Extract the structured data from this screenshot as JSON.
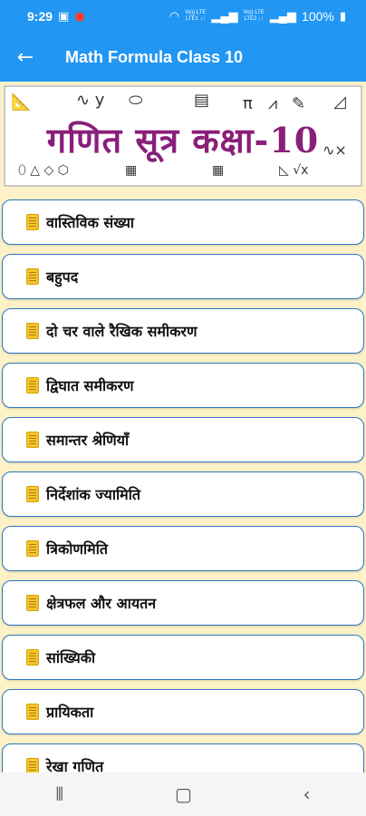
{
  "status": {
    "time": "9:29",
    "lte1": "Vo)) LTE\nLTE1 ↓↑",
    "lte2": "Vo)) LTE\nLTE2 ↓↑",
    "battery": "100%"
  },
  "appbar": {
    "title": "Math Formula Class 10"
  },
  "banner": {
    "title": "गणित सूत्र कक्षा-10"
  },
  "topics": [
    "वास्तिविक संख्या",
    "बहुपद",
    "दो चर वाले रैखिक समीकरण",
    "द्विघात समीकरण",
    "समान्तर श्रेणियाँ",
    "निर्देशांक ज्यामिति",
    "त्रिकोणमिति",
    "क्षेत्रफल और आयतन",
    "सांख्यिकी",
    "प्रायिकता",
    "रेखा गणित"
  ],
  "colors": {
    "primary": "#2196f3",
    "card_border": "#2c78c2",
    "background": "#fdf1c8",
    "banner_text": "#8a1f7a"
  },
  "icons": {
    "back": "arrow-left-icon",
    "topic": "book-icon",
    "nav_recents": "recents-icon",
    "nav_home": "home-icon",
    "nav_back": "back-icon"
  }
}
